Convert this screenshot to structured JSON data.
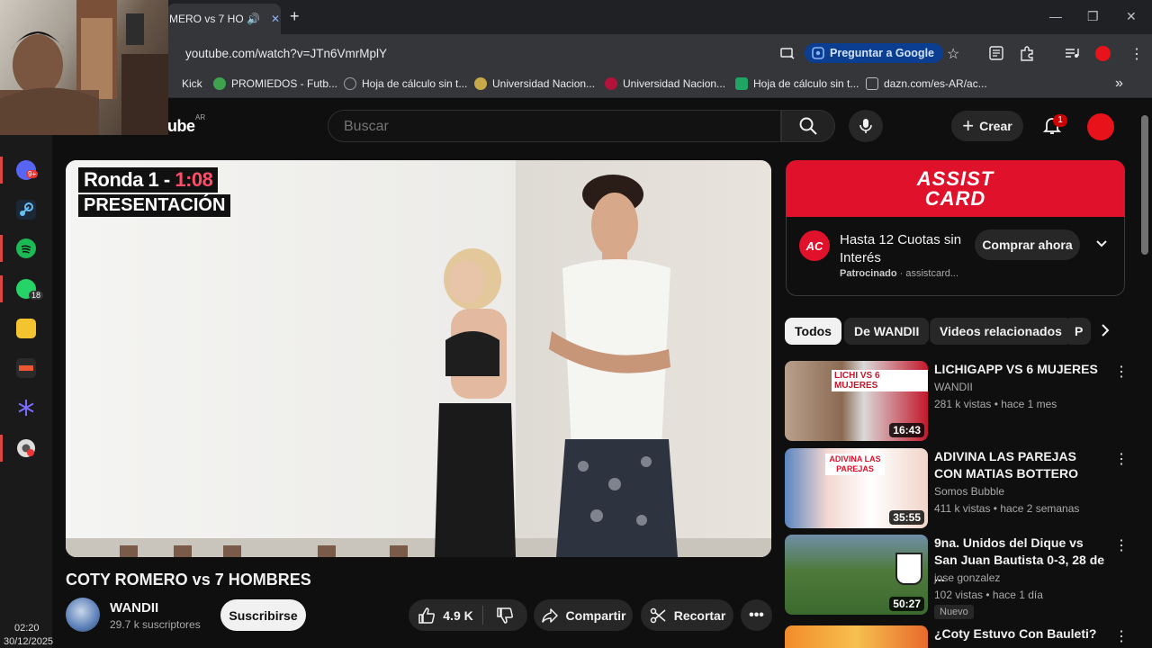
{
  "browser": {
    "tab_title": "MERO vs 7 HO",
    "new_tab": "+",
    "url": "youtube.com/watch?v=JTn6VmrMplY",
    "ask_google": "Preguntar a Google",
    "win_min": "—",
    "win_max": "❐",
    "win_close": "✕"
  },
  "bookmarks": [
    {
      "label": "Kick",
      "color": "#53fc18"
    },
    {
      "label": "PROMIEDOS - Futb...",
      "color": "#3fa34d"
    },
    {
      "label": "Hoja de cálculo sin t...",
      "color": "#9aa0a6"
    },
    {
      "label": "Universidad Nacion...",
      "color": "#c7a94a"
    },
    {
      "label": "Universidad Nacion...",
      "color": "#b3123b"
    },
    {
      "label": "Hoja de cálculo sin t...",
      "color": "#1fa463"
    },
    {
      "label": "dazn.com/es-AR/ac...",
      "color": "#bdbdbd"
    }
  ],
  "taskbar": {
    "badge_whatsapp": "18",
    "badge_discord": "9+",
    "time": "02:20",
    "date": "30/12/2025"
  },
  "header": {
    "logo_tail": "ube",
    "region": "AR",
    "search_placeholder": "Buscar",
    "create_label": "Crear",
    "notif_count": "1"
  },
  "video": {
    "overlay_round": "Ronda 1 - ",
    "overlay_time": "1:08",
    "overlay_title": "PRESENTACIÓN",
    "title": "COTY ROMERO vs 7 HOMBRES",
    "channel": "WANDII",
    "subscribers": "29.7 k suscriptores",
    "subscribe": "Suscribirse",
    "likes": "4.9 K",
    "share": "Compartir",
    "clip": "Recortar"
  },
  "ad": {
    "brand_line1": "ASSIST",
    "brand_line2": "CARD",
    "logo_text": "AC",
    "headline": "Hasta 12 Cuotas sin Interés",
    "sponsored": "Patrocinado",
    "advertiser": "assistcard...",
    "cta": "Comprar ahora"
  },
  "chips": [
    "Todos",
    "De WANDII",
    "Videos relacionados",
    "P"
  ],
  "recommendations": [
    {
      "title": "LICHIGAPP VS 6 MUJERES",
      "channel": "WANDII",
      "meta": "281 k vistas • hace 1 mes",
      "duration": "16:43",
      "thumb_text": "LICHI VS 6 MUJERES"
    },
    {
      "title": "ADIVINA LAS PAREJAS CON MATIAS BOTTERO",
      "channel": "Somos Bubble",
      "meta": "411 k vistas • hace 2 semanas",
      "duration": "35:55",
      "thumb_text": "ADIVINA LAS PAREJAS"
    },
    {
      "title": "9na. Unidos del Dique vs San Juan Bautista 0-3, 28 de ...",
      "channel": "jose gonzalez",
      "meta": "102 vistas • hace 1 día",
      "duration": "50:27",
      "badge": "Nuevo"
    },
    {
      "title": "¿Coty Estuvo Con Bauleti?",
      "channel": "",
      "meta": "",
      "duration": ""
    }
  ],
  "colors": {
    "yt_red": "#ff0000",
    "ad_red": "#e0112b",
    "bg": "#0f0f0f"
  }
}
